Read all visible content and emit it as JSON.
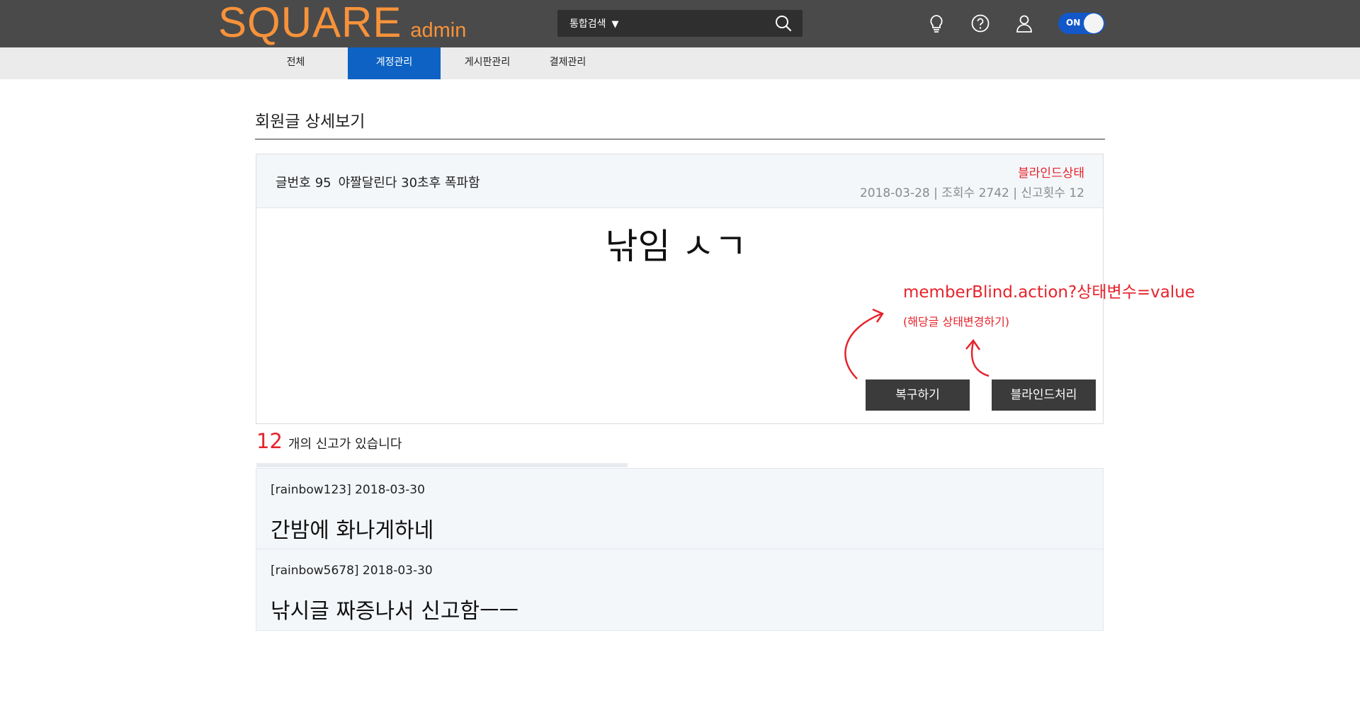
{
  "header": {
    "logo_main": "SQUARE",
    "logo_sub": "admin",
    "search_scope": "통합검색",
    "search_caret": "▼",
    "toggle_label": "ON",
    "icons": [
      "lightbulb-icon",
      "help-icon",
      "user-icon",
      "search-icon"
    ]
  },
  "nav": {
    "tabs": [
      {
        "label": "전체",
        "active": false
      },
      {
        "label": "계정관리",
        "active": true
      },
      {
        "label": "게시판관리",
        "active": false
      },
      {
        "label": "결제관리",
        "active": false
      }
    ]
  },
  "page": {
    "title": "회원글 상세보기"
  },
  "post": {
    "number_label": "글번호",
    "number": "95",
    "subject": "야짤달린다 30초후 폭파함",
    "state": "블라인드상태",
    "meta": "2018-03-28 | 조회수 2742 | 신고횟수 12",
    "body": "낚임 ㅅㄱ",
    "restore_button": "복구하기",
    "blind_button": "블라인드처리"
  },
  "annotation": {
    "line1": "memberBlind.action?상태변수=value",
    "line2": "(해당글 상태변경하기)"
  },
  "reports": {
    "count": "12",
    "summary_text": "개의 신고가 있습니다",
    "items": [
      {
        "meta": "[rainbow123] 2018-03-30",
        "content": "간밤에 화나게하네"
      },
      {
        "meta": "[rainbow5678] 2018-03-30",
        "content": "낚시글 짜증나서 신고함ㅡㅡ"
      }
    ]
  },
  "colors": {
    "topbar": "#4a4a4a",
    "logo": "#f7923a",
    "active_tab": "#0d62c4",
    "alert_red": "#e5232b",
    "button_dark": "#3b3b3b"
  }
}
